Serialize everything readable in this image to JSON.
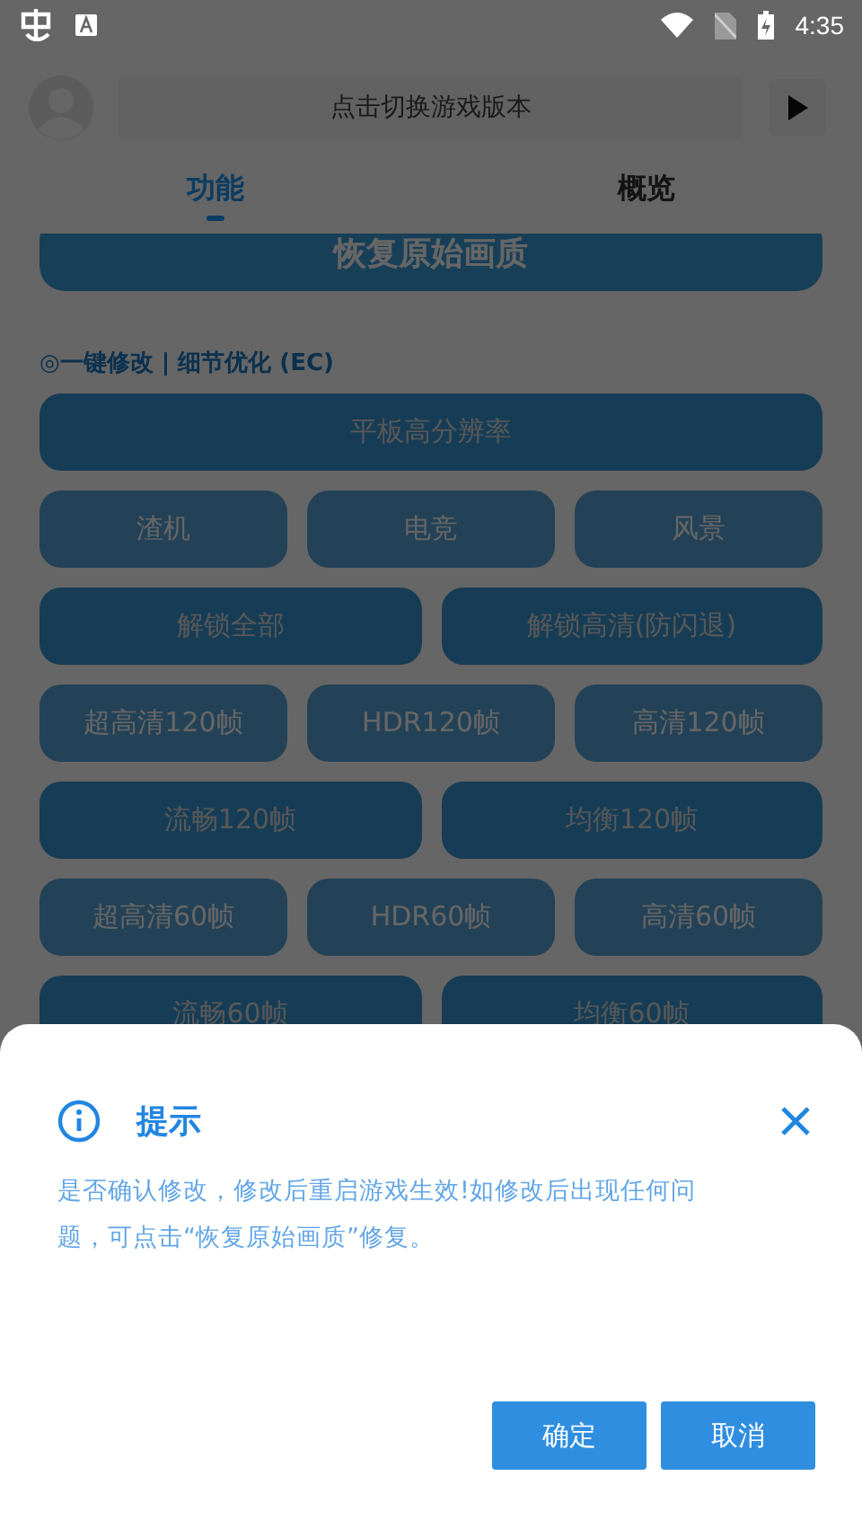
{
  "status_bar": {
    "time": "4:35"
  },
  "header": {
    "version_field": {
      "placeholder": "点击切换游戏版本"
    }
  },
  "tabs": [
    {
      "label": "功能",
      "selected": true
    },
    {
      "label": "概览",
      "selected": false
    }
  ],
  "restore_button": "恢复原始画质",
  "section_title": "◎一键修改 | 细节优化 (EC)",
  "button_rows": [
    [
      {
        "label": "平板高分辨率",
        "kind": "primary"
      }
    ],
    [
      {
        "label": "渣机",
        "kind": "secondary"
      },
      {
        "label": "电竞",
        "kind": "secondary"
      },
      {
        "label": "风景",
        "kind": "secondary"
      }
    ],
    [
      {
        "label": "解锁全部",
        "kind": "primary"
      },
      {
        "label": "解锁高清(防闪退)",
        "kind": "primary"
      }
    ],
    [
      {
        "label": "超高清120帧",
        "kind": "secondary"
      },
      {
        "label": "HDR120帧",
        "kind": "secondary"
      },
      {
        "label": "高清120帧",
        "kind": "secondary"
      }
    ],
    [
      {
        "label": "流畅120帧",
        "kind": "primary"
      },
      {
        "label": "均衡120帧",
        "kind": "primary"
      }
    ],
    [
      {
        "label": "超高清60帧",
        "kind": "secondary"
      },
      {
        "label": "HDR60帧",
        "kind": "secondary"
      },
      {
        "label": "高清60帧",
        "kind": "secondary"
      }
    ],
    [
      {
        "label": "流畅60帧",
        "kind": "primary"
      },
      {
        "label": "均衡60帧",
        "kind": "primary"
      }
    ]
  ],
  "dialog": {
    "title": "提示",
    "message": "是否确认修改，修改后重启游戏生效!如修改后出现任何问题，可点击“恢复原始画质”修复。",
    "buttons": [
      "确定",
      "取消"
    ]
  }
}
